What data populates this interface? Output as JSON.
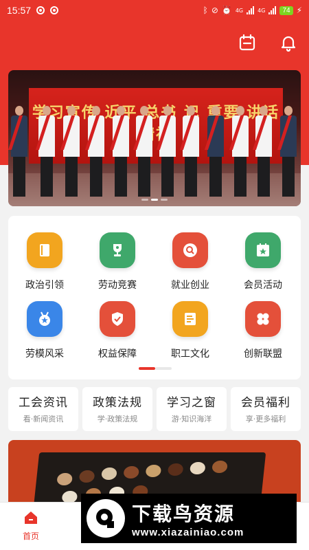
{
  "status_bar": {
    "time": "15:57",
    "signal1": "4G",
    "signal2": "4G",
    "battery": "74"
  },
  "header": {
    "calendar_icon": "calendar-icon",
    "bell_icon": "bell-icon"
  },
  "banner": {
    "screen_text": "学习宣传  近平 总书 记 重要 讲话精神"
  },
  "grid": {
    "items": [
      {
        "label": "政治引领",
        "icon": "book-icon",
        "color": "#f2a51f"
      },
      {
        "label": "劳动竞赛",
        "icon": "trophy-icon",
        "color": "#3fa86b"
      },
      {
        "label": "就业创业",
        "icon": "search-icon",
        "color": "#e4503a"
      },
      {
        "label": "会员活动",
        "icon": "calendar-star-icon",
        "color": "#3fa86b"
      },
      {
        "label": "劳模风采",
        "icon": "medal-icon",
        "color": "#3a86e8"
      },
      {
        "label": "权益保障",
        "icon": "shield-check-icon",
        "color": "#e4503a"
      },
      {
        "label": "职工文化",
        "icon": "document-icon",
        "color": "#f2a51f"
      },
      {
        "label": "创新联盟",
        "icon": "clover-icon",
        "color": "#e4503a"
      }
    ]
  },
  "quick_links": [
    {
      "title": "工会资讯",
      "sub": "看·新闻资讯"
    },
    {
      "title": "政策法规",
      "sub": "学·政策法规"
    },
    {
      "title": "学习之窗",
      "sub": "游·知识海洋"
    },
    {
      "title": "会员福利",
      "sub": "享·更多福利"
    }
  ],
  "bottom_nav": {
    "home_label": "首页"
  },
  "watermark": {
    "title": "下载鸟资源",
    "url": "www.xiazainiao.com"
  },
  "colors": {
    "primary": "#e8352b"
  }
}
